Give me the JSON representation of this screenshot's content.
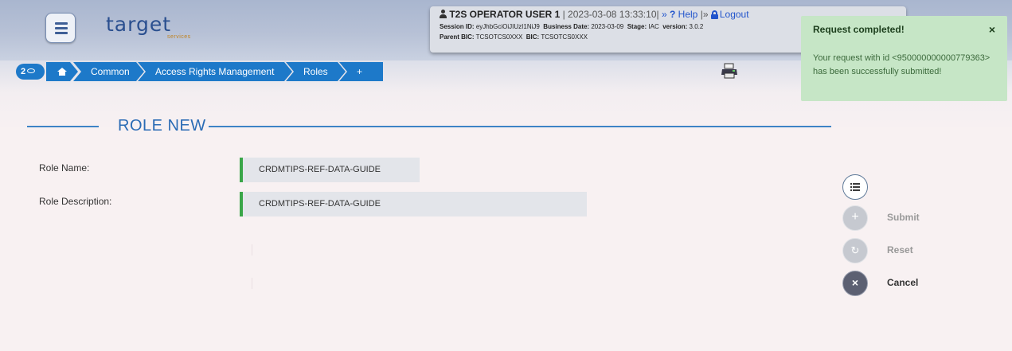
{
  "app": {
    "logo_text": "target",
    "logo_sub": "services"
  },
  "user": {
    "name": "T2S OPERATOR USER 1",
    "datetime": "| 2023-03-08 13:33:10|",
    "help_prefix": "»",
    "help_mark": "?",
    "help_label": "Help",
    "sep": "|»",
    "logout_label": "Logout",
    "session_label": "Session ID:",
    "session_value": "eyJhbGciOiJIUzI1NiJ9",
    "business_date_label": "Business Date:",
    "business_date_value": "2023-03-09",
    "stage_label": "Stage:",
    "stage_value": "IAC",
    "version_label": "version:",
    "version_value": "3.0.2",
    "parent_bic_label": "Parent BIC:",
    "parent_bic_value": "TCSOTCS0XXX",
    "bic_label": "BIC:",
    "bic_value": "TCSOTCS0XXX"
  },
  "breadcrumb": {
    "badge_count": "2",
    "items": [
      "Common",
      "Access Rights Management",
      "Roles"
    ],
    "new_label": "+ New"
  },
  "toast": {
    "title": "Request completed!",
    "close": "×",
    "message": "Your request with id <950000000000779363> has been successfully submitted!"
  },
  "page": {
    "title": "ROLE NEW"
  },
  "form": {
    "role_name_label": "Role Name:",
    "role_name_value": "CRDMTIPS-REF-DATA-GUIDE",
    "role_desc_label": "Role Description:",
    "role_desc_value": "CRDMTIPS-REF-DATA-GUIDE"
  },
  "actions": {
    "submit_label": "Submit",
    "reset_label": "Reset",
    "cancel_label": "Cancel",
    "plus_glyph": "+",
    "reset_glyph": "↻",
    "cancel_glyph": "×"
  },
  "colors": {
    "accent": "#1d79c9",
    "title_blue": "#2a6bb5",
    "field_border_green": "#3aa648",
    "toast_bg": "#c6e6c6"
  }
}
